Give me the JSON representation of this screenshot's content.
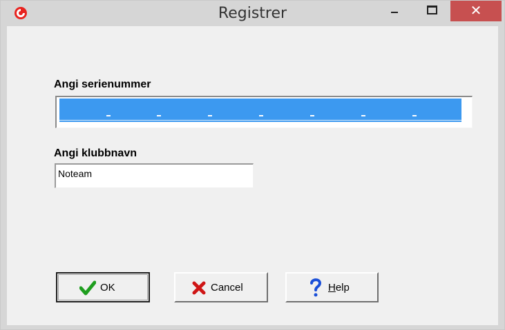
{
  "window": {
    "title": "Registrer",
    "close_glyph": "✕",
    "icons": {
      "app": "app-logo-icon",
      "minimize": "minimize-icon",
      "maximize": "maximize-icon",
      "close": "close-icon"
    },
    "colors": {
      "close_button": "#c75050",
      "chrome": "#d6d6d6",
      "client": "#f0f0f0",
      "selection": "#3c99f0"
    }
  },
  "form": {
    "serial_label": "Angi serienummer",
    "serial_value": "",
    "club_label": "Angi klubbnavn",
    "club_value": "Noteam"
  },
  "buttons": {
    "ok": "OK",
    "cancel": "Cancel",
    "help_mnemonic": "H",
    "help_rest": "elp"
  }
}
